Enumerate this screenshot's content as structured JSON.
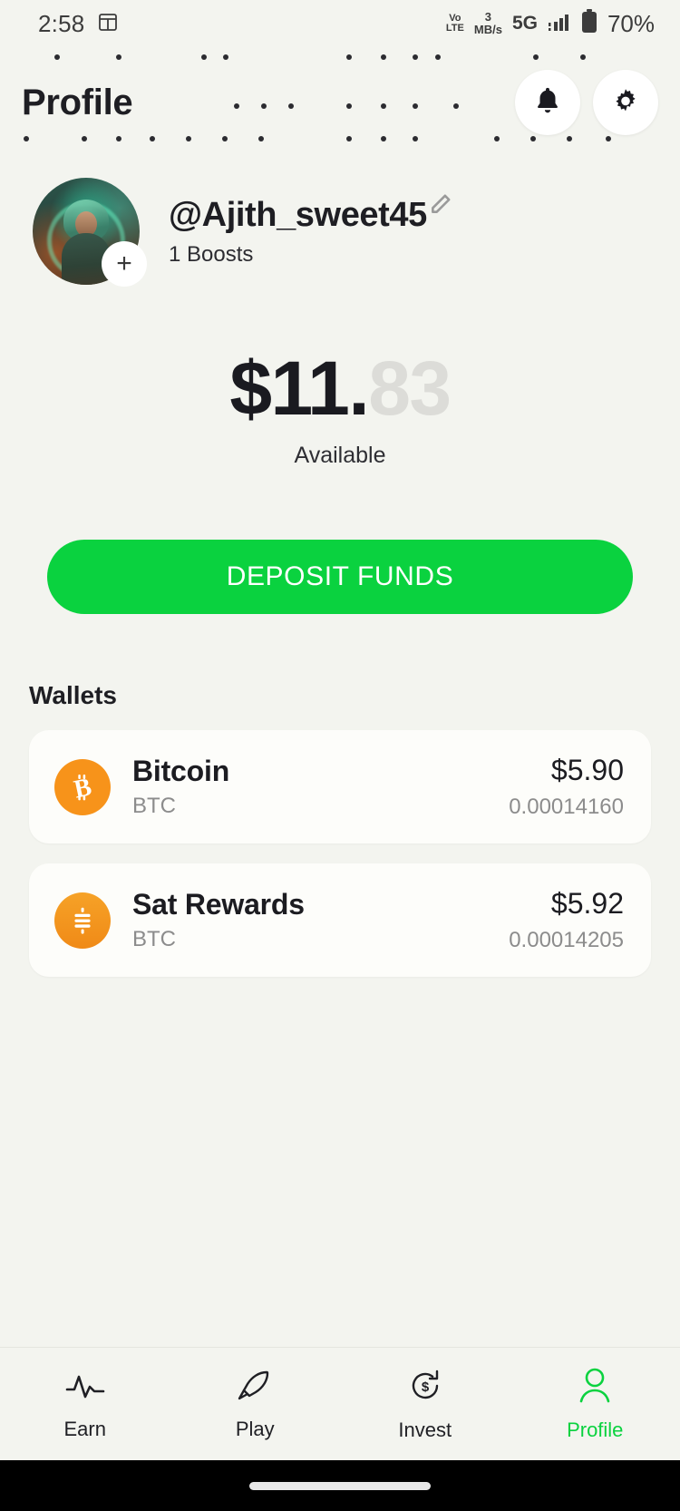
{
  "status_bar": {
    "time": "2:58",
    "calendar_icon": "calendar-icon",
    "volte_top": "Vo",
    "volte_bottom": "LTE",
    "net_speed_value": "3",
    "net_speed_unit": "MB/s",
    "network": "5G",
    "signal_icon": "signal-bars-icon",
    "battery_icon": "battery-icon",
    "battery_percent": "70%"
  },
  "header": {
    "title": "Profile",
    "notifications_icon": "bell-icon",
    "settings_icon": "gear-icon"
  },
  "profile": {
    "avatar_name": "avatar",
    "add_badge": "+",
    "username": "@Ajith_sweet45",
    "edit_icon": "pencil-icon",
    "boosts": "1 Boosts"
  },
  "balance": {
    "dollars": "$11.",
    "cents": "83",
    "label": "Available"
  },
  "deposit": {
    "label": "DEPOSIT FUNDS",
    "color": "#0ad23f"
  },
  "wallets": {
    "heading": "Wallets",
    "items": [
      {
        "icon": "bitcoin-icon",
        "name": "Bitcoin",
        "symbol": "BTC",
        "fiat": "$5.90",
        "amount": "0.00014160",
        "color": "#f7931a"
      },
      {
        "icon": "sat-rewards-icon",
        "name": "Sat Rewards",
        "symbol": "BTC",
        "fiat": "$5.92",
        "amount": "0.00014205",
        "color": "#f7931a"
      }
    ]
  },
  "bottom_nav": {
    "items": [
      {
        "label": "Earn",
        "icon": "pulse-icon",
        "active": false
      },
      {
        "label": "Play",
        "icon": "rocket-icon",
        "active": false
      },
      {
        "label": "Invest",
        "icon": "dollar-refresh-icon",
        "active": false
      },
      {
        "label": "Profile",
        "icon": "person-icon",
        "active": true
      }
    ],
    "active_color": "#0ad23f"
  }
}
